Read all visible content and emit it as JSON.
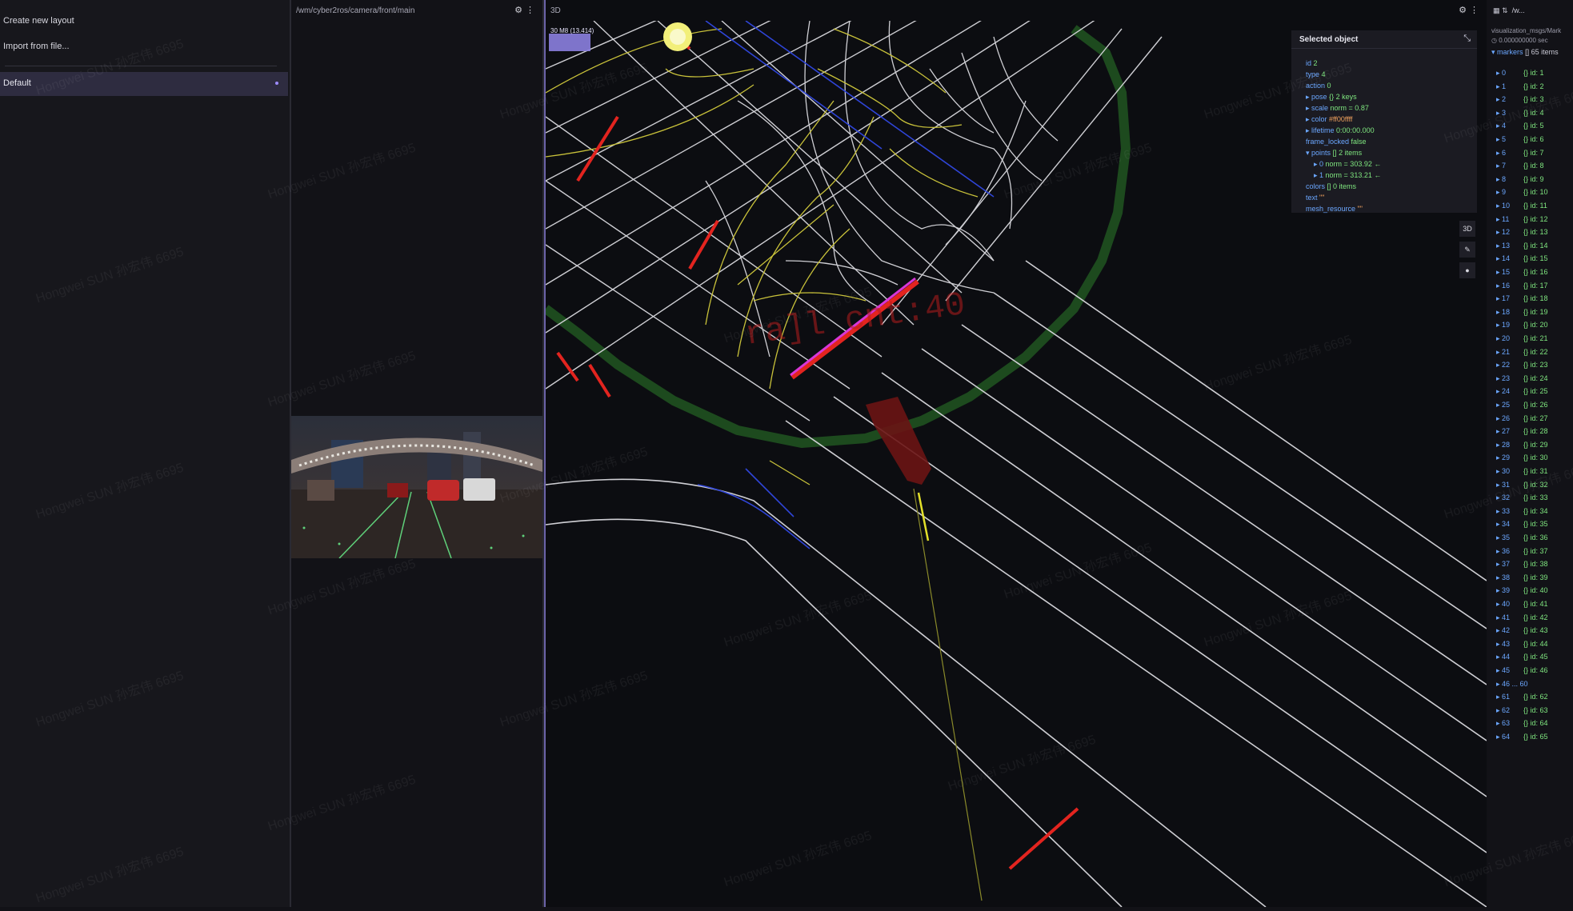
{
  "layouts_panel": {
    "create_label": "Create new layout",
    "import_label": "Import from file...",
    "layout_name": "Default"
  },
  "camera_panel": {
    "topic": "/wm/cyber2ros/camera/front/main",
    "settings_icon": "gear-icon",
    "menu_icon": "more-vertical-icon"
  },
  "view3d_panel": {
    "title": "3D",
    "badge": "30 M8 (13.414)",
    "overlay_text": "ra]l  cnt:40",
    "tools": [
      "3D",
      "ruler-icon",
      "point-icon"
    ],
    "colors": {
      "lane": "#cfcfd4",
      "yellow_lane": "#c9c23a",
      "blue_lane": "#2f45d8",
      "boundary": "#1d4a1e",
      "stop_line": "#e3241f",
      "selected": "#d837d8"
    }
  },
  "selected_object": {
    "title": "Selected object",
    "fields": [
      {
        "key": "id",
        "value": "2"
      },
      {
        "key": "type",
        "value": "4"
      },
      {
        "key": "action",
        "value": "0"
      },
      {
        "key": "pose",
        "value": "{} 2 keys"
      },
      {
        "key": "scale",
        "value": "norm = 0.87"
      },
      {
        "key": "color",
        "value": "#ff00ffff"
      },
      {
        "key": "lifetime",
        "value": "0:00:00.000"
      },
      {
        "key": "frame_locked",
        "value": "false"
      },
      {
        "key": "points",
        "value": "[] 2 items"
      },
      {
        "key": "0",
        "value": "norm = 303.92 ←"
      },
      {
        "key": "1",
        "value": "norm = 313.21 ←"
      },
      {
        "key": "colors",
        "value": "[] 0 items"
      },
      {
        "key": "text",
        "value": "\"\""
      },
      {
        "key": "mesh_resource",
        "value": "\"\""
      }
    ]
  },
  "raw_panel": {
    "title": "/w...",
    "type_label": "visualization_msgs/Mark",
    "time": "0.000000000 sec",
    "markers_label": "markers",
    "markers_count": "[] 65 items",
    "rows": [
      {
        "i": "0",
        "v": "{} id: 1"
      },
      {
        "i": "1",
        "v": "{} id: 2"
      },
      {
        "i": "2",
        "v": "{} id: 3"
      },
      {
        "i": "3",
        "v": "{} id: 4"
      },
      {
        "i": "4",
        "v": "{} id: 5"
      },
      {
        "i": "5",
        "v": "{} id: 6"
      },
      {
        "i": "6",
        "v": "{} id: 7"
      },
      {
        "i": "7",
        "v": "{} id: 8"
      },
      {
        "i": "8",
        "v": "{} id: 9"
      },
      {
        "i": "9",
        "v": "{} id: 10"
      },
      {
        "i": "10",
        "v": "{} id: 11"
      },
      {
        "i": "11",
        "v": "{} id: 12"
      },
      {
        "i": "12",
        "v": "{} id: 13"
      },
      {
        "i": "13",
        "v": "{} id: 14"
      },
      {
        "i": "14",
        "v": "{} id: 15"
      },
      {
        "i": "15",
        "v": "{} id: 16"
      },
      {
        "i": "16",
        "v": "{} id: 17"
      },
      {
        "i": "17",
        "v": "{} id: 18"
      },
      {
        "i": "18",
        "v": "{} id: 19"
      },
      {
        "i": "19",
        "v": "{} id: 20"
      },
      {
        "i": "20",
        "v": "{} id: 21"
      },
      {
        "i": "21",
        "v": "{} id: 22"
      },
      {
        "i": "22",
        "v": "{} id: 23"
      },
      {
        "i": "23",
        "v": "{} id: 24"
      },
      {
        "i": "24",
        "v": "{} id: 25"
      },
      {
        "i": "25",
        "v": "{} id: 26"
      },
      {
        "i": "26",
        "v": "{} id: 27"
      },
      {
        "i": "27",
        "v": "{} id: 28"
      },
      {
        "i": "28",
        "v": "{} id: 29"
      },
      {
        "i": "29",
        "v": "{} id: 30"
      },
      {
        "i": "30",
        "v": "{} id: 31"
      },
      {
        "i": "31",
        "v": "{} id: 32"
      },
      {
        "i": "32",
        "v": "{} id: 33"
      },
      {
        "i": "33",
        "v": "{} id: 34"
      },
      {
        "i": "34",
        "v": "{} id: 35"
      },
      {
        "i": "35",
        "v": "{} id: 36"
      },
      {
        "i": "36",
        "v": "{} id: 37"
      },
      {
        "i": "37",
        "v": "{} id: 38"
      },
      {
        "i": "38",
        "v": "{} id: 39"
      },
      {
        "i": "39",
        "v": "{} id: 40"
      },
      {
        "i": "40",
        "v": "{} id: 41"
      },
      {
        "i": "41",
        "v": "{} id: 42"
      },
      {
        "i": "42",
        "v": "{} id: 43"
      },
      {
        "i": "43",
        "v": "{} id: 44"
      },
      {
        "i": "44",
        "v": "{} id: 45"
      },
      {
        "i": "45",
        "v": "{} id: 46"
      },
      {
        "i": "46 ... 60",
        "v": ""
      },
      {
        "i": "61",
        "v": "{} id: 62"
      },
      {
        "i": "62",
        "v": "{} id: 63"
      },
      {
        "i": "63",
        "v": "{} id: 64"
      },
      {
        "i": "64",
        "v": "{} id: 65"
      }
    ]
  },
  "watermark": "Hongwei SUN 孙宏伟 6695"
}
